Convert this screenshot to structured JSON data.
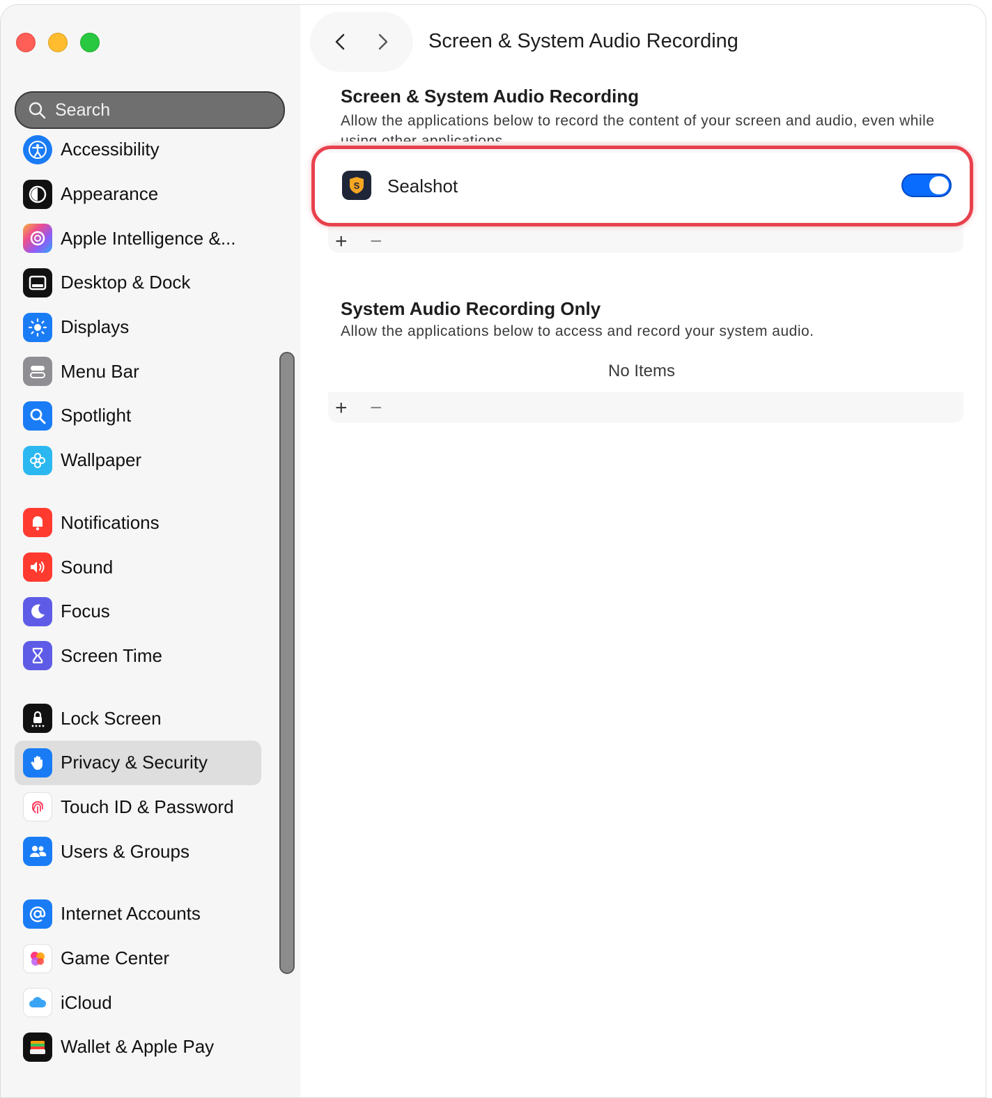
{
  "window": {
    "title": "Screen & System Audio Recording"
  },
  "search": {
    "placeholder": "Search"
  },
  "sidebar": {
    "items": [
      {
        "label": "Accessibility",
        "icon": "accessibility-icon",
        "color": "#1a7cf5"
      },
      {
        "label": "Appearance",
        "icon": "appearance-icon",
        "color": "#111111"
      },
      {
        "label": "Apple Intelligence &...",
        "icon": "apple-intelligence-icon",
        "color": "#f0a040"
      },
      {
        "label": "Desktop & Dock",
        "icon": "desktop-dock-icon",
        "color": "#111111"
      },
      {
        "label": "Displays",
        "icon": "displays-icon",
        "color": "#1a7cf5"
      },
      {
        "label": "Menu Bar",
        "icon": "menu-bar-icon",
        "color": "#8e8e93"
      },
      {
        "label": "Spotlight",
        "icon": "spotlight-icon",
        "color": "#1a7cf5"
      },
      {
        "label": "Wallpaper",
        "icon": "wallpaper-icon",
        "color": "#2bb8f0"
      },
      {
        "label": "Notifications",
        "icon": "notifications-icon",
        "color": "#ff3b30"
      },
      {
        "label": "Sound",
        "icon": "sound-icon",
        "color": "#ff3b30"
      },
      {
        "label": "Focus",
        "icon": "focus-icon",
        "color": "#5e5ce6"
      },
      {
        "label": "Screen Time",
        "icon": "screen-time-icon",
        "color": "#5e5ce6"
      },
      {
        "label": "Lock Screen",
        "icon": "lock-screen-icon",
        "color": "#111111"
      },
      {
        "label": "Privacy & Security",
        "icon": "privacy-hand-icon",
        "color": "#1a7cf5"
      },
      {
        "label": "Touch ID & Password",
        "icon": "touch-id-icon",
        "color": "#ffffff"
      },
      {
        "label": "Users & Groups",
        "icon": "users-groups-icon",
        "color": "#1a7cf5"
      },
      {
        "label": "Internet Accounts",
        "icon": "internet-accounts-icon",
        "color": "#1a7cf5"
      },
      {
        "label": "Game Center",
        "icon": "game-center-icon",
        "color": "#ffffff"
      },
      {
        "label": "iCloud",
        "icon": "icloud-icon",
        "color": "#ffffff"
      },
      {
        "label": "Wallet & Apple Pay",
        "icon": "wallet-icon",
        "color": "#111111"
      }
    ],
    "active": "Privacy & Security"
  },
  "section1": {
    "title": "Screen & System Audio Recording",
    "description": "Allow the applications below to record the content of your screen and audio, even while using other applications.",
    "apps": [
      {
        "name": "Sealshot",
        "enabled": true
      }
    ],
    "add_label": "+",
    "remove_label": "−"
  },
  "section2": {
    "title": "System Audio Recording Only",
    "description": "Allow the applications below to access and record your system audio.",
    "empty_label": "No Items",
    "add_label": "+",
    "remove_label": "−"
  },
  "colors": {
    "accent": "#0a6cff",
    "highlight": "#e8414d"
  }
}
